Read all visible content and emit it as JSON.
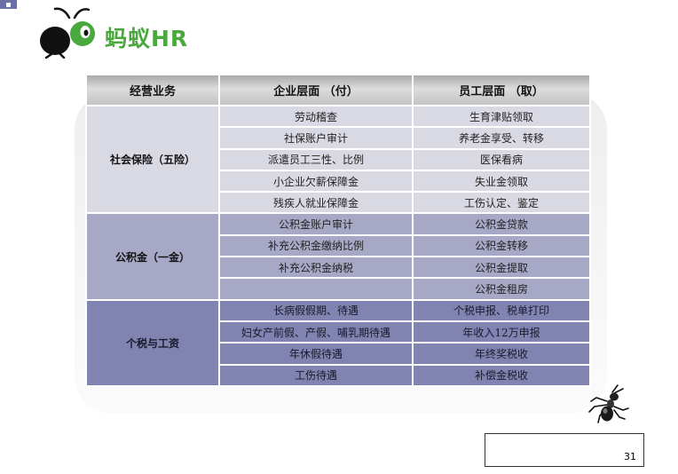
{
  "brand": {
    "text": "蚂蚁HR",
    "color": "#4aa83f"
  },
  "table": {
    "headers": [
      "经营业务",
      "企业层面 （付）",
      "员工层面 （取）"
    ],
    "sections": [
      {
        "category": "社会保险（五险）",
        "rows": [
          [
            "劳动稽查",
            "生育津贴领取"
          ],
          [
            "社保账户审计",
            "养老金享受、转移"
          ],
          [
            "派遣员工三性、比例",
            "医保看病"
          ],
          [
            "小企业欠薪保障金",
            "失业金领取"
          ],
          [
            "残疾人就业保障金",
            "工伤认定、鉴定"
          ]
        ]
      },
      {
        "category": "公积金（一金）",
        "rows": [
          [
            "公积金账户审计",
            "公积金贷款"
          ],
          [
            "补充公积金缴纳比例",
            "公积金转移"
          ],
          [
            "补充公积金纳税",
            "公积金提取"
          ],
          [
            "",
            "公积金租房"
          ]
        ]
      },
      {
        "category": "个税与工资",
        "rows": [
          [
            "长病假假期、待遇",
            "个税申报、税单打印"
          ],
          [
            "妇女产前假、产假、哺乳期待遇",
            "年收入12万申报"
          ],
          [
            "年休假待遇",
            "年终奖税收"
          ],
          [
            "工伤待遇",
            "补偿金税收"
          ]
        ]
      }
    ]
  },
  "colors": {
    "section1": "#d9d9e4",
    "section2": "#a7a8c6",
    "section3": "#8183b0"
  },
  "footer": {
    "page_number": "31"
  }
}
